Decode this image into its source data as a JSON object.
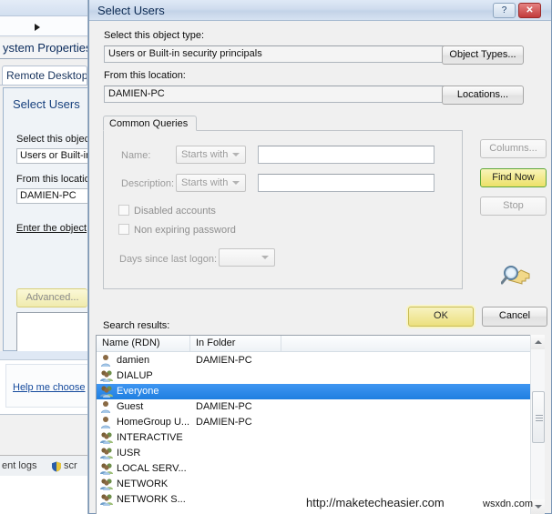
{
  "background": {
    "system_properties_title": "ystem Properties",
    "remote_desktop_tab": "Remote Desktop",
    "dialog_title": "Select Users",
    "object_type_label": "Select this objec",
    "object_type_value": "Users or Built-in",
    "location_label": "From this location",
    "location_value": "DAMIEN-PC",
    "enter_object_label": "Enter the object",
    "advanced_button": "Advanced...",
    "help_link": "Help me choose",
    "status_left": "ent logs",
    "status_right": "scr",
    "shield_icon": "shield-icon",
    "dropdown_icon": "triangle-right-icon"
  },
  "titlebar": {
    "title": "Select Users",
    "help_button": "?",
    "close_button": "✕",
    "help_icon": "question-mark-icon",
    "close_icon": "close-x-icon"
  },
  "form": {
    "object_type_label": "Select this object type:",
    "object_type_value": "Users or Built-in security principals",
    "object_types_button": "Object Types...",
    "location_label": "From this location:",
    "location_value": "DAMIEN-PC",
    "locations_button": "Locations..."
  },
  "common_queries": {
    "tab_label": "Common Queries",
    "name_label": "Name:",
    "name_operator": "Starts with",
    "name_value": "",
    "name_placeholder": "",
    "description_label": "Description:",
    "description_operator": "Starts with",
    "description_value": "",
    "description_placeholder": "",
    "disabled_accounts_label": "Disabled accounts",
    "disabled_accounts_checked": false,
    "non_expiring_label": "Non expiring password",
    "non_expiring_checked": false,
    "days_label": "Days since last logon:",
    "days_value": "",
    "dropdown_icon": "chevron-down-icon"
  },
  "side_buttons": {
    "columns": "Columns...",
    "find_now": "Find Now",
    "stop": "Stop",
    "search_icon": "magnifier-key-icon"
  },
  "dialog_buttons": {
    "ok": "OK",
    "cancel": "Cancel"
  },
  "results": {
    "label": "Search results:",
    "columns": [
      "Name (RDN)",
      "In Folder",
      ""
    ],
    "rows": [
      {
        "icon": "user-icon",
        "name": "damien",
        "folder": "DAMIEN-PC",
        "selected": false
      },
      {
        "icon": "group-icon",
        "name": "DIALUP",
        "folder": "",
        "selected": false
      },
      {
        "icon": "group-icon",
        "name": "Everyone",
        "folder": "",
        "selected": true
      },
      {
        "icon": "user-icon",
        "name": "Guest",
        "folder": "DAMIEN-PC",
        "selected": false
      },
      {
        "icon": "user-icon",
        "name": "HomeGroup U...",
        "folder": "DAMIEN-PC",
        "selected": false
      },
      {
        "icon": "group-icon",
        "name": "INTERACTIVE",
        "folder": "",
        "selected": false
      },
      {
        "icon": "group-icon",
        "name": "IUSR",
        "folder": "",
        "selected": false
      },
      {
        "icon": "group-icon",
        "name": "LOCAL SERV...",
        "folder": "",
        "selected": false
      },
      {
        "icon": "group-icon",
        "name": "NETWORK",
        "folder": "",
        "selected": false
      },
      {
        "icon": "group-icon",
        "name": "NETWORK S...",
        "folder": "",
        "selected": false
      }
    ],
    "scrollbar": {
      "up_icon": "scroll-up-arrow-icon",
      "down_icon": "scroll-down-arrow-icon"
    }
  },
  "watermarks": {
    "primary": "http://maketecheasier.com",
    "secondary": "wsxdn.com"
  },
  "colors": {
    "selection_blue": "#2d8cf0",
    "default_button_yellow": "#ece07e",
    "find_now_green_border": "#5fa83c",
    "close_red": "#c23b3b",
    "dialog_face": "#f0f0f0"
  }
}
